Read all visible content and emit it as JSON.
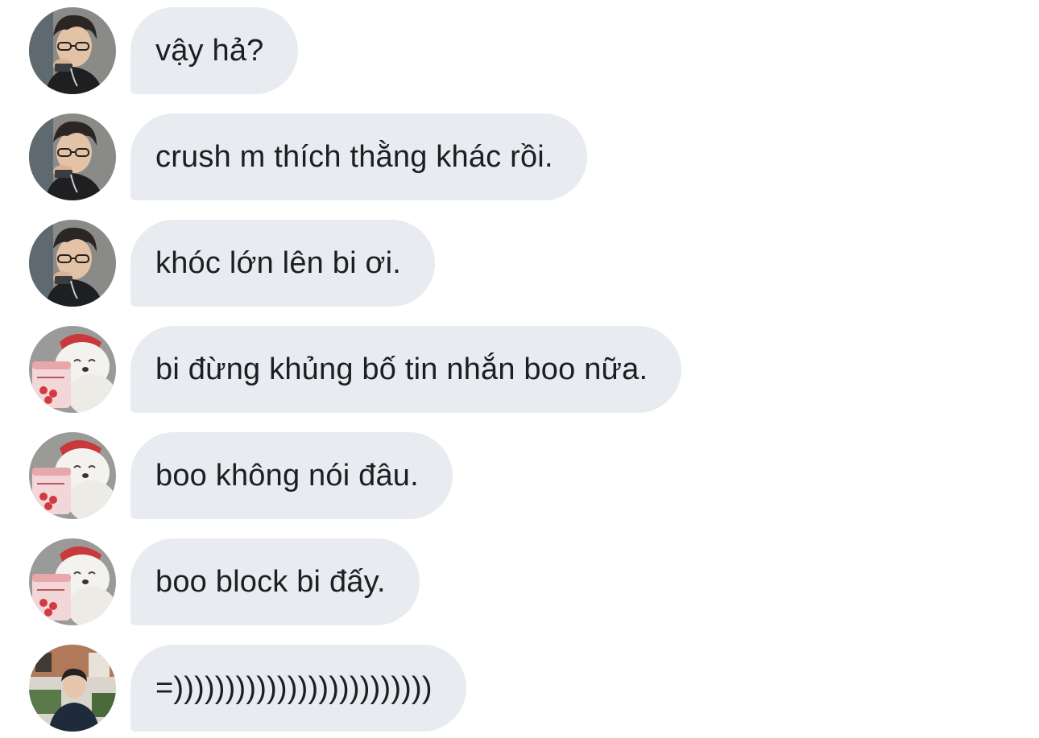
{
  "messages": [
    {
      "sender": "guy-glasses",
      "avatar_icon": "person-with-glasses-avatar-icon",
      "text": "vậy hả?"
    },
    {
      "sender": "guy-glasses",
      "avatar_icon": "person-with-glasses-avatar-icon",
      "text": "crush m thích thằng khác rồi."
    },
    {
      "sender": "guy-glasses",
      "avatar_icon": "person-with-glasses-avatar-icon",
      "text": "khóc lớn lên bi ơi."
    },
    {
      "sender": "bear",
      "avatar_icon": "polar-bear-ice-cream-avatar-icon",
      "text": "bi đừng khủng bố tin nhắn boo nữa."
    },
    {
      "sender": "bear",
      "avatar_icon": "polar-bear-ice-cream-avatar-icon",
      "text": "boo không nói đâu."
    },
    {
      "sender": "bear",
      "avatar_icon": "polar-bear-ice-cream-avatar-icon",
      "text": "boo block bi đấy."
    },
    {
      "sender": "guy-street",
      "avatar_icon": "person-street-avatar-icon",
      "text": "=)))))))))))))))))))))))))"
    }
  ],
  "colors": {
    "bubble_background": "#e8ebef",
    "text": "#1c1e21",
    "page_background": "#ffffff"
  }
}
